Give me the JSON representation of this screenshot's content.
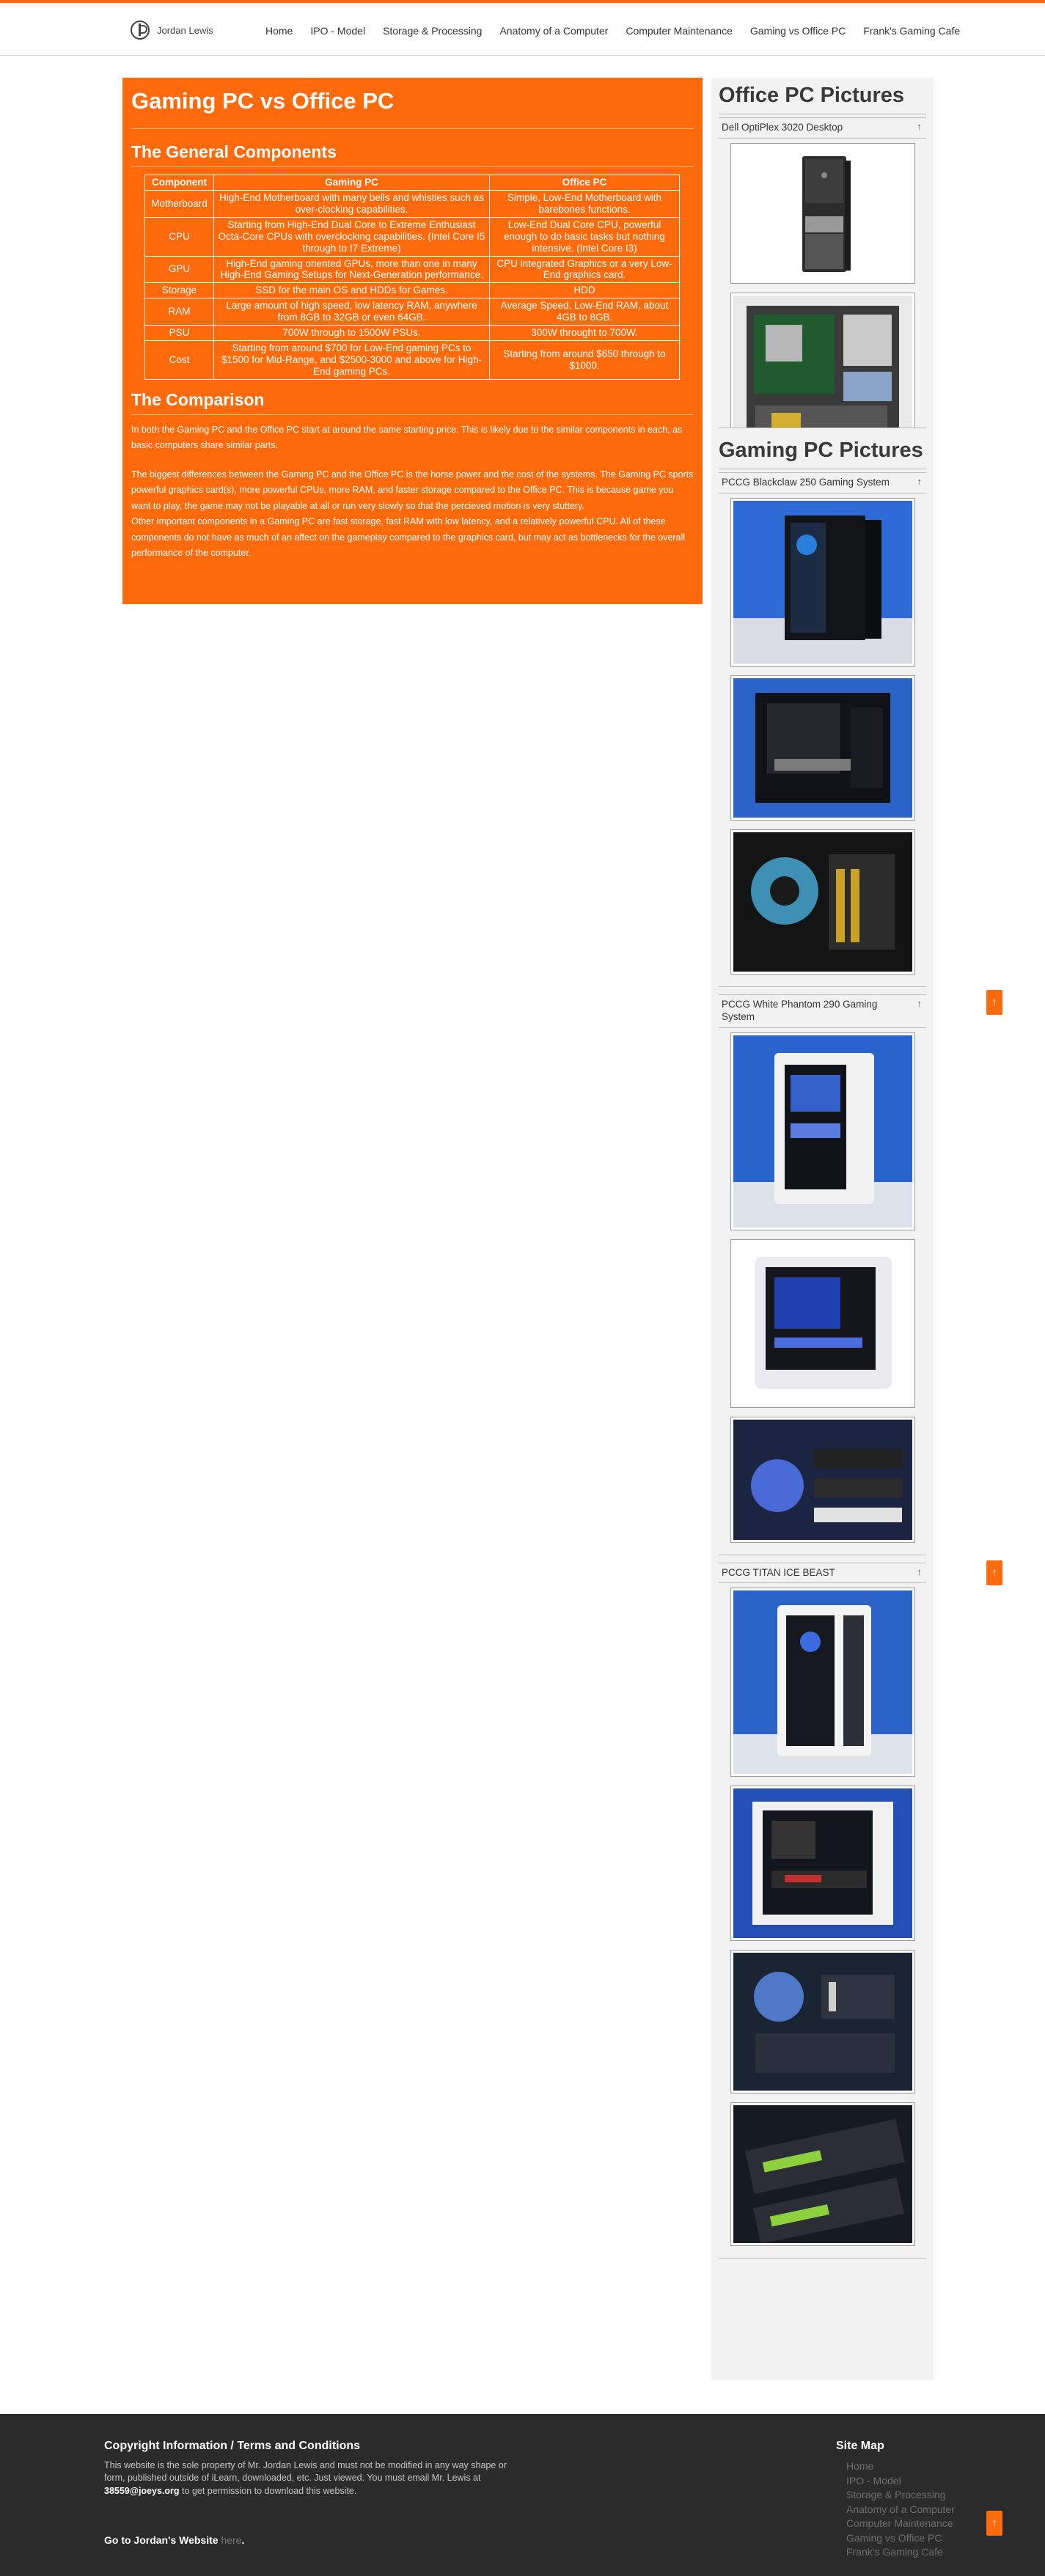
{
  "header": {
    "logo_text": "Jordan Lewis",
    "nav": [
      "Home",
      "IPO - Model",
      "Storage & Processing",
      "Anatomy of a Computer",
      "Computer Maintenance",
      "Gaming vs Office PC",
      "Frank's Gaming Cafe"
    ]
  },
  "main": {
    "title": "Gaming PC vs Office PC",
    "components_heading": "The General Components",
    "table": {
      "headers": [
        "Component",
        "Gaming PC",
        "Office PC"
      ],
      "rows": [
        [
          "Motherboard",
          "High-End Motherboard with many bells and whistles such as over-clocking capabilities.",
          "Simple, Low-End Motherboard with barebones functions."
        ],
        [
          "CPU",
          "Starting from High-End Dual Core to Extreme Enthusiast Octa-Core CPUs with overclocking capabilities. (Intel Core I5 through to I7 Extreme)",
          "Low-End Dual Core CPU, powerful enough to do basic tasks but nothing intensive. (Intel Core I3)"
        ],
        [
          "GPU",
          "High-End gaming oriented GPUs, more than one in many High-End Gaming Setups for Next-Generation performance.",
          "CPU integrated Graphics or a very Low-End graphics card."
        ],
        [
          "Storage",
          "SSD for the main OS and HDDs for Games.",
          "HDD"
        ],
        [
          "RAM",
          "Large amount of high speed, low latency RAM, anywhere from 8GB to 32GB or even 64GB.",
          "Average Speed, Low-End RAM, about 4GB to 8GB."
        ],
        [
          "PSU",
          "700W through to 1500W PSUs.",
          "300W throught to 700W."
        ],
        [
          "Cost",
          "Starting from around $700 for Low-End gaming PCs to $1500 for Mid-Range, and $2500-3000 and above for High-End gaming PCs.",
          "Starting from around $650 through to $1000."
        ]
      ]
    },
    "comparison_heading": "The Comparison",
    "paragraph1": "In both the Gaming PC and the Office PC start at around the same starting price. This is likely due to the similar components in each, as basic computers share similar parts.",
    "paragraph2": "The biggest differences between the Gaming PC and the Office PC is the horse power and the cost of the systems. The Gaming PC sports powerful graphics card(s), more powerful CPUs, more RAM, and faster storage compared to the Office PC. This is because game you want to play, the game may not be playable at all or run very slowly so that the percieved motion is very stuttery.",
    "paragraph3": "Other important components in a Gaming PC are fast storage, fast RAM with low latency, and a relatively powerful CPU. All of these components do not have as much of an affect on the gameplay compared to the graphics card, but may act as bottlenecks for the overall performance of the computer."
  },
  "sidebar": {
    "office_title": "Office PC Pictures",
    "gaming_title": "Gaming PC Pictures",
    "galleries": [
      {
        "name": "Dell OptiPlex 3020 Desktop",
        "arrow": "↑"
      },
      {
        "name": "PCCG Blackclaw 250 Gaming System",
        "arrow": "↑"
      },
      {
        "name": "PCCG White Phantom 290 Gaming System",
        "arrow": "↑"
      },
      {
        "name": "PCCG TITAN ICE BEAST",
        "arrow": "↑"
      }
    ]
  },
  "totop": "↑",
  "footer": {
    "copyright_title": "Copyright Information / Terms and Conditions",
    "copyright_text": "This website is the sole property of Mr. Jordan Lewis and must not be modified in any way shape or form, published outside of iLearn, downloaded, etc. Just viewed. You must email Mr. Lewis at",
    "email": "38559@joeys.org",
    "copyright_text2": "to get permission to download this website.",
    "link_text": "Go to Jordan's Website",
    "link_here": "here",
    "link_period": ".",
    "sitemap_title": "Site Map",
    "sitemap": [
      "Home",
      "IPO - Model",
      "Storage & Processing",
      "Anatomy of a Computer",
      "Computer Maintenance",
      "Gaming vs Office PC",
      "Frank's Gaming Cafe"
    ]
  }
}
